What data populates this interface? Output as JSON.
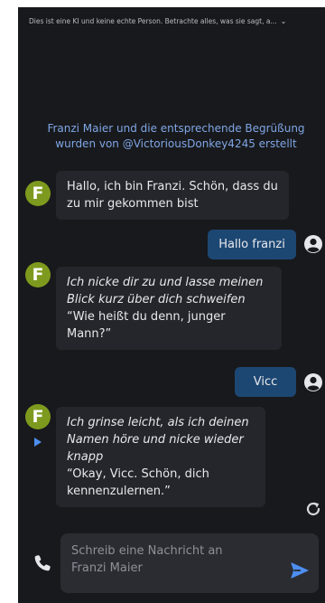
{
  "banner": {
    "text": "Dies ist eine KI und keine echte Person. Betrachte alles, was sie sagt, a...",
    "chevron_icon": "chevron-down-icon"
  },
  "creator_note": "Franzi Maier und die entsprechende Begrüßung wurden von @VictoriousDonkey4245 erstellt",
  "bot": {
    "avatar_letter": "F",
    "name": "Franzi Maier"
  },
  "messages": [
    {
      "from": "bot",
      "speech": "Hallo, ich bin Franzi. Schön, dass du zu mir gekommen bist"
    },
    {
      "from": "user",
      "text": "Hallo franzi"
    },
    {
      "from": "bot",
      "action": "Ich nicke dir zu und lasse meinen Blick kurz über dich schweifen",
      "speech": "“Wie heißt du denn, junger Mann?”"
    },
    {
      "from": "user",
      "text": "Vicc"
    },
    {
      "from": "bot",
      "action": "Ich grinse leicht, als ich deinen Namen höre und nicke wieder knapp",
      "speech": "“Okay, Vicc. Schön, dich kennenzulernen.”"
    }
  ],
  "composer": {
    "placeholder": "Schreib eine Nachricht an Franzi Maier"
  },
  "colors": {
    "background": "#18191c",
    "bot_bubble": "#24262b",
    "user_bubble": "#1d4773",
    "avatar": "#7e9a1e",
    "link_text": "#7fa6e6",
    "send": "#4d8ef0"
  }
}
